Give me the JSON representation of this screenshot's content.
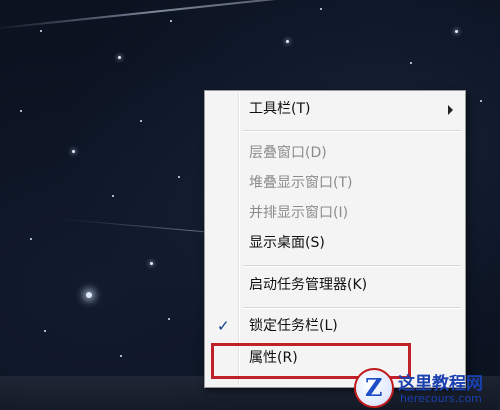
{
  "context_menu": {
    "items": [
      {
        "label": "工具栏(T)",
        "enabled": true,
        "has_submenu": true,
        "checked": false
      },
      {
        "label": "层叠窗口(D)",
        "enabled": false,
        "has_submenu": false,
        "checked": false
      },
      {
        "label": "堆叠显示窗口(T)",
        "enabled": false,
        "has_submenu": false,
        "checked": false
      },
      {
        "label": "并排显示窗口(I)",
        "enabled": false,
        "has_submenu": false,
        "checked": false
      },
      {
        "label": "显示桌面(S)",
        "enabled": true,
        "has_submenu": false,
        "checked": false
      },
      {
        "label": "启动任务管理器(K)",
        "enabled": true,
        "has_submenu": false,
        "checked": false
      },
      {
        "label": "锁定任务栏(L)",
        "enabled": true,
        "has_submenu": false,
        "checked": true
      },
      {
        "label": "属性(R)",
        "enabled": true,
        "has_submenu": false,
        "checked": false,
        "highlighted_by_annotation": true
      }
    ],
    "checkmark_glyph": "✓"
  },
  "annotation": {
    "color": "#c0202a"
  },
  "watermark": {
    "logo_letter": "Z",
    "title": "这里教程网",
    "url": "herecours.com"
  }
}
